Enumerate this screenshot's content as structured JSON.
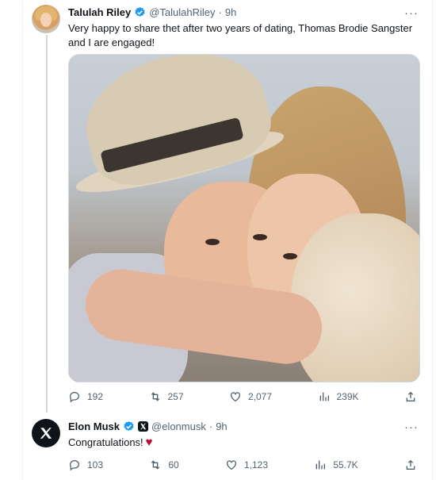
{
  "tweet": {
    "author_name": "Talulah Riley",
    "handle": "@TalulahRiley",
    "separator": "·",
    "time": "9h",
    "more": "···",
    "text": "Very happy to share thet after two years of dating, Thomas Brodie Sangster and I are engaged!",
    "stats": {
      "replies": "192",
      "reposts": "257",
      "likes": "2,077",
      "views": "239K"
    }
  },
  "reply": {
    "author_name": "Elon Musk",
    "handle": "@elonmusk",
    "separator": "·",
    "time": "9h",
    "more": "···",
    "text": "Congratulations!",
    "emoji": "♥",
    "stats": {
      "replies": "103",
      "reposts": "60",
      "likes": "1,123",
      "views": "55.7K"
    }
  },
  "colors": {
    "verified_blue": "#1d9bf0",
    "muted_text": "#536471",
    "heart_red": "#c00a27"
  },
  "icons": [
    "reply-icon",
    "repost-icon",
    "like-icon",
    "views-icon",
    "share-icon",
    "verified-badge-icon",
    "x-logo-icon",
    "more-icon"
  ]
}
